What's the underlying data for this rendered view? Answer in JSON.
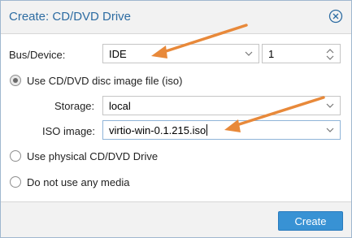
{
  "dialog": {
    "title": "Create: CD/DVD Drive",
    "close_icon": "close-circle-icon"
  },
  "form": {
    "bus_device_label": "Bus/Device:",
    "bus_value": "IDE",
    "device_number": "1",
    "iso_option_label": "Use CD/DVD disc image file (iso)",
    "storage_label": "Storage:",
    "storage_value": "local",
    "iso_image_label": "ISO image:",
    "iso_image_value": "virtio-win-0.1.215.iso",
    "physical_option_label": "Use physical CD/DVD Drive",
    "no_media_option_label": "Do not use any media",
    "selected_option": "iso"
  },
  "footer": {
    "create_label": "Create"
  },
  "colors": {
    "title": "#2d6ca2",
    "primary_button": "#3892d4",
    "annotation_arrow": "#e8893a"
  },
  "annotations": {
    "arrows": 2
  }
}
